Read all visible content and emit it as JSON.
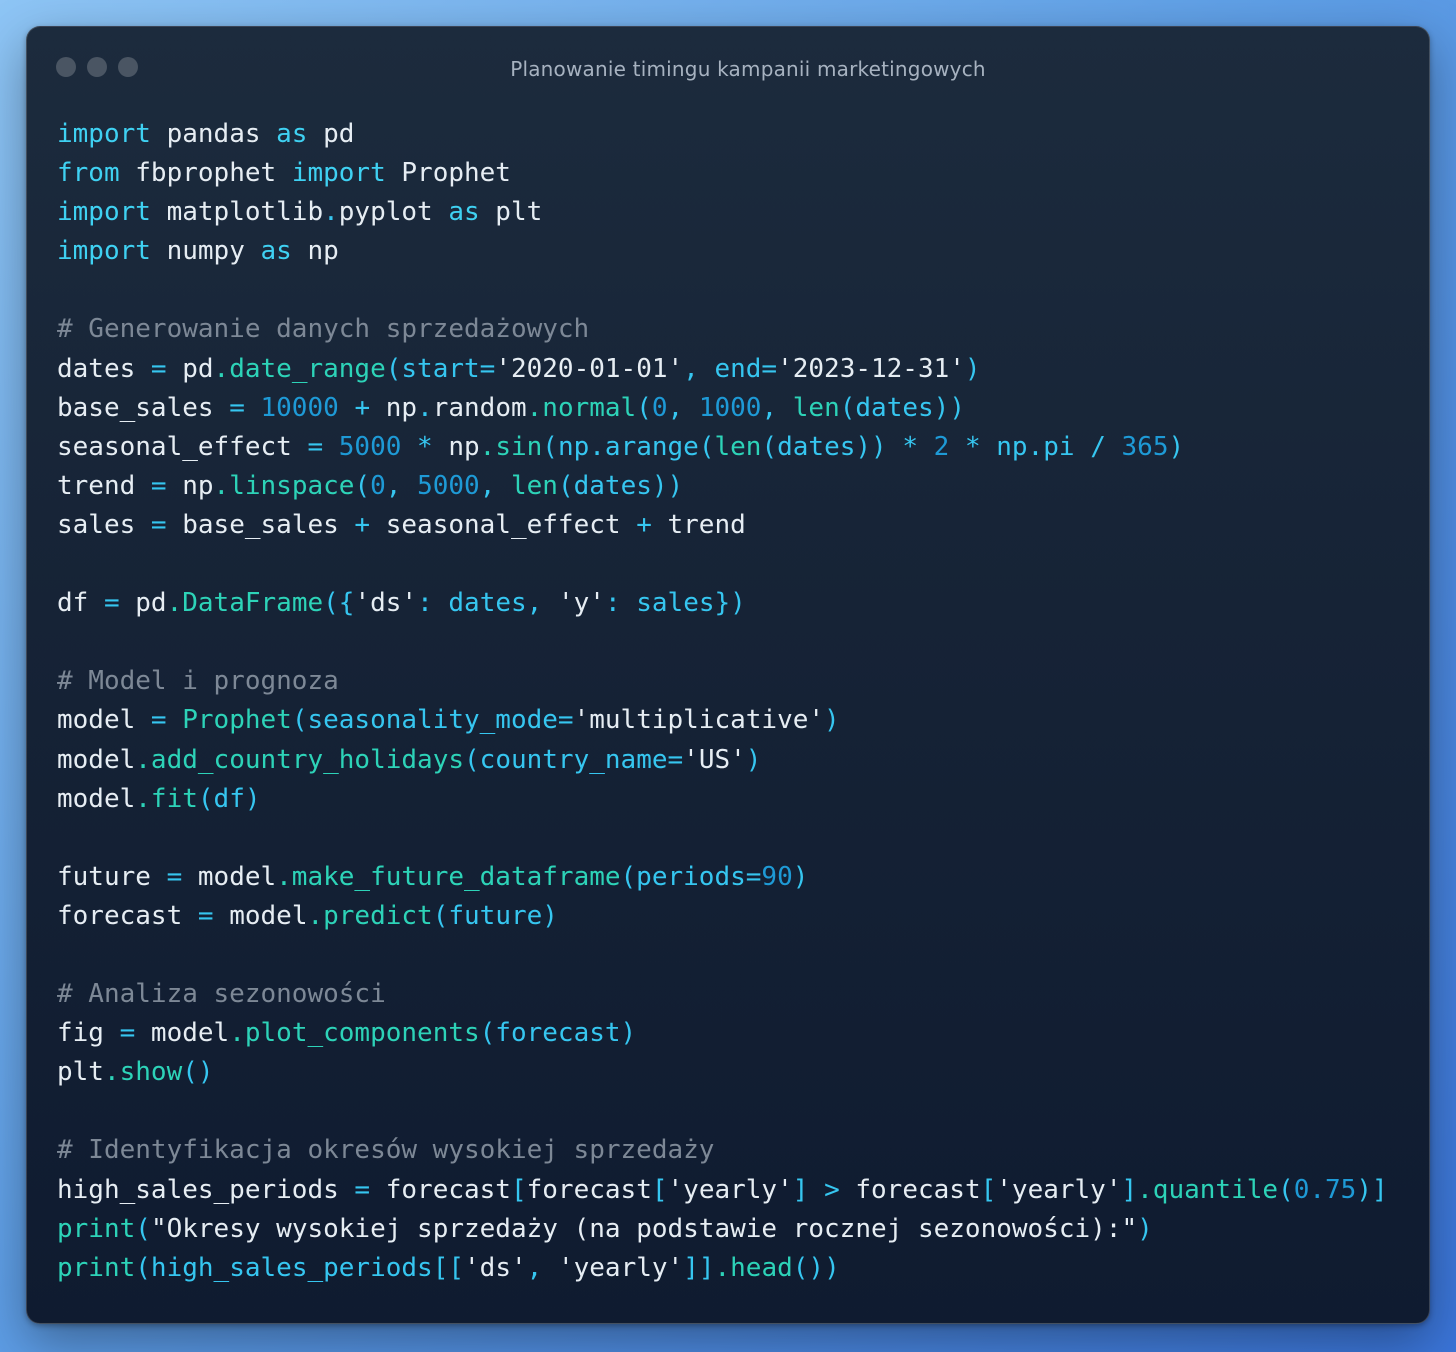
{
  "window": {
    "title": "Planowanie timingu kampanii marketingowych",
    "traffic_light_icons": [
      "close-dot",
      "minimize-dot",
      "zoom-dot"
    ]
  },
  "code": {
    "language": "python",
    "lines": [
      [
        {
          "t": "kw",
          "v": "import"
        },
        {
          "t": "id",
          "v": " pandas "
        },
        {
          "t": "kw",
          "v": "as"
        },
        {
          "t": "id",
          "v": " pd"
        }
      ],
      [
        {
          "t": "kw",
          "v": "from"
        },
        {
          "t": "id",
          "v": " fbprophet "
        },
        {
          "t": "kw",
          "v": "import"
        },
        {
          "t": "id",
          "v": " Prophet"
        }
      ],
      [
        {
          "t": "kw",
          "v": "import"
        },
        {
          "t": "id",
          "v": " matplotlib"
        },
        {
          "t": "pu",
          "v": "."
        },
        {
          "t": "id",
          "v": "pyplot "
        },
        {
          "t": "kw",
          "v": "as"
        },
        {
          "t": "id",
          "v": " plt"
        }
      ],
      [
        {
          "t": "kw",
          "v": "import"
        },
        {
          "t": "id",
          "v": " numpy "
        },
        {
          "t": "kw",
          "v": "as"
        },
        {
          "t": "id",
          "v": " np"
        }
      ],
      [],
      [
        {
          "t": "cm",
          "v": "# Generowanie danych sprzedażowych"
        }
      ],
      [
        {
          "t": "id",
          "v": "dates "
        },
        {
          "t": "op",
          "v": "="
        },
        {
          "t": "id",
          "v": " pd"
        },
        {
          "t": "fn",
          "v": ".date_range"
        },
        {
          "t": "pu",
          "v": "(start="
        },
        {
          "t": "str",
          "v": "'2020-01-01'"
        },
        {
          "t": "pu",
          "v": ", end="
        },
        {
          "t": "str",
          "v": "'2023-12-31'"
        },
        {
          "t": "pu",
          "v": ")"
        }
      ],
      [
        {
          "t": "id",
          "v": "base_sales "
        },
        {
          "t": "op",
          "v": "="
        },
        {
          "t": "id",
          "v": " "
        },
        {
          "t": "num",
          "v": "10000"
        },
        {
          "t": "id",
          "v": " "
        },
        {
          "t": "op",
          "v": "+"
        },
        {
          "t": "id",
          "v": " np"
        },
        {
          "t": "pu",
          "v": "."
        },
        {
          "t": "id",
          "v": "random"
        },
        {
          "t": "fn",
          "v": ".normal"
        },
        {
          "t": "pu",
          "v": "("
        },
        {
          "t": "num",
          "v": "0"
        },
        {
          "t": "pu",
          "v": ", "
        },
        {
          "t": "num",
          "v": "1000"
        },
        {
          "t": "pu",
          "v": ", "
        },
        {
          "t": "fn",
          "v": "len"
        },
        {
          "t": "pu",
          "v": "(dates))"
        }
      ],
      [
        {
          "t": "id",
          "v": "seasonal_effect "
        },
        {
          "t": "op",
          "v": "="
        },
        {
          "t": "id",
          "v": " "
        },
        {
          "t": "num",
          "v": "5000"
        },
        {
          "t": "id",
          "v": " "
        },
        {
          "t": "op",
          "v": "*"
        },
        {
          "t": "id",
          "v": " np"
        },
        {
          "t": "fn",
          "v": ".sin"
        },
        {
          "t": "pu",
          "v": "(np.arange("
        },
        {
          "t": "fn",
          "v": "len"
        },
        {
          "t": "pu",
          "v": "(dates)) "
        },
        {
          "t": "op",
          "v": "*"
        },
        {
          "t": "id",
          "v": " "
        },
        {
          "t": "num",
          "v": "2"
        },
        {
          "t": "id",
          "v": " "
        },
        {
          "t": "op",
          "v": "*"
        },
        {
          "t": "pu",
          "v": " np.pi "
        },
        {
          "t": "op",
          "v": "/"
        },
        {
          "t": "id",
          "v": " "
        },
        {
          "t": "num",
          "v": "365"
        },
        {
          "t": "pu",
          "v": ")"
        }
      ],
      [
        {
          "t": "id",
          "v": "trend "
        },
        {
          "t": "op",
          "v": "="
        },
        {
          "t": "id",
          "v": " np"
        },
        {
          "t": "fn",
          "v": ".linspace"
        },
        {
          "t": "pu",
          "v": "("
        },
        {
          "t": "num",
          "v": "0"
        },
        {
          "t": "pu",
          "v": ", "
        },
        {
          "t": "num",
          "v": "5000"
        },
        {
          "t": "pu",
          "v": ", "
        },
        {
          "t": "fn",
          "v": "len"
        },
        {
          "t": "pu",
          "v": "(dates))"
        }
      ],
      [
        {
          "t": "id",
          "v": "sales "
        },
        {
          "t": "op",
          "v": "="
        },
        {
          "t": "id",
          "v": " base_sales "
        },
        {
          "t": "op",
          "v": "+"
        },
        {
          "t": "id",
          "v": " seasonal_effect "
        },
        {
          "t": "op",
          "v": "+"
        },
        {
          "t": "id",
          "v": " trend"
        }
      ],
      [],
      [
        {
          "t": "id",
          "v": "df "
        },
        {
          "t": "op",
          "v": "="
        },
        {
          "t": "id",
          "v": " pd"
        },
        {
          "t": "fn",
          "v": ".DataFrame"
        },
        {
          "t": "pu",
          "v": "({"
        },
        {
          "t": "str",
          "v": "'ds'"
        },
        {
          "t": "pu",
          "v": ": dates, "
        },
        {
          "t": "str",
          "v": "'y'"
        },
        {
          "t": "pu",
          "v": ": sales})"
        }
      ],
      [],
      [
        {
          "t": "cm",
          "v": "# Model i prognoza"
        }
      ],
      [
        {
          "t": "id",
          "v": "model "
        },
        {
          "t": "op",
          "v": "="
        },
        {
          "t": "id",
          "v": " "
        },
        {
          "t": "fn",
          "v": "Prophet"
        },
        {
          "t": "pu",
          "v": "(seasonality_mode="
        },
        {
          "t": "str",
          "v": "'multiplicative'"
        },
        {
          "t": "pu",
          "v": ")"
        }
      ],
      [
        {
          "t": "id",
          "v": "model"
        },
        {
          "t": "fn",
          "v": ".add_country_holidays"
        },
        {
          "t": "pu",
          "v": "(country_name="
        },
        {
          "t": "str",
          "v": "'US'"
        },
        {
          "t": "pu",
          "v": ")"
        }
      ],
      [
        {
          "t": "id",
          "v": "model"
        },
        {
          "t": "fn",
          "v": ".fit"
        },
        {
          "t": "pu",
          "v": "(df)"
        }
      ],
      [],
      [
        {
          "t": "id",
          "v": "future "
        },
        {
          "t": "op",
          "v": "="
        },
        {
          "t": "id",
          "v": " model"
        },
        {
          "t": "fn",
          "v": ".make_future_dataframe"
        },
        {
          "t": "pu",
          "v": "(periods="
        },
        {
          "t": "num",
          "v": "90"
        },
        {
          "t": "pu",
          "v": ")"
        }
      ],
      [
        {
          "t": "id",
          "v": "forecast "
        },
        {
          "t": "op",
          "v": "="
        },
        {
          "t": "id",
          "v": " model"
        },
        {
          "t": "fn",
          "v": ".predict"
        },
        {
          "t": "pu",
          "v": "(future)"
        }
      ],
      [],
      [
        {
          "t": "cm",
          "v": "# Analiza sezonowości"
        }
      ],
      [
        {
          "t": "id",
          "v": "fig "
        },
        {
          "t": "op",
          "v": "="
        },
        {
          "t": "id",
          "v": " model"
        },
        {
          "t": "fn",
          "v": ".plot_components"
        },
        {
          "t": "pu",
          "v": "(forecast)"
        }
      ],
      [
        {
          "t": "id",
          "v": "plt"
        },
        {
          "t": "fn",
          "v": ".show"
        },
        {
          "t": "pu",
          "v": "()"
        }
      ],
      [],
      [
        {
          "t": "cm",
          "v": "# Identyfikacja okresów wysokiej sprzedaży"
        }
      ],
      [
        {
          "t": "id",
          "v": "high_sales_periods "
        },
        {
          "t": "op",
          "v": "="
        },
        {
          "t": "id",
          "v": " forecast"
        },
        {
          "t": "pu",
          "v": "["
        },
        {
          "t": "id",
          "v": "forecast"
        },
        {
          "t": "pu",
          "v": "["
        },
        {
          "t": "str",
          "v": "'yearly'"
        },
        {
          "t": "pu",
          "v": "] "
        },
        {
          "t": "op",
          "v": ">"
        },
        {
          "t": "id",
          "v": " forecast"
        },
        {
          "t": "pu",
          "v": "["
        },
        {
          "t": "str",
          "v": "'yearly'"
        },
        {
          "t": "pu",
          "v": "]"
        },
        {
          "t": "fn",
          "v": ".quantile"
        },
        {
          "t": "pu",
          "v": "("
        },
        {
          "t": "num",
          "v": "0.75"
        },
        {
          "t": "pu",
          "v": ")]"
        }
      ],
      [
        {
          "t": "fn",
          "v": "print"
        },
        {
          "t": "pu",
          "v": "("
        },
        {
          "t": "str",
          "v": "\"Okresy wysokiej sprzedaży (na podstawie rocznej sezonowości):\""
        },
        {
          "t": "pu",
          "v": ")"
        }
      ],
      [
        {
          "t": "fn",
          "v": "print"
        },
        {
          "t": "pu",
          "v": "(high_sales_periods[["
        },
        {
          "t": "str",
          "v": "'ds'"
        },
        {
          "t": "pu",
          "v": ", "
        },
        {
          "t": "str",
          "v": "'yearly'"
        },
        {
          "t": "pu",
          "v": "]]"
        },
        {
          "t": "fn",
          "v": ".head"
        },
        {
          "t": "pu",
          "v": "())"
        }
      ]
    ]
  }
}
